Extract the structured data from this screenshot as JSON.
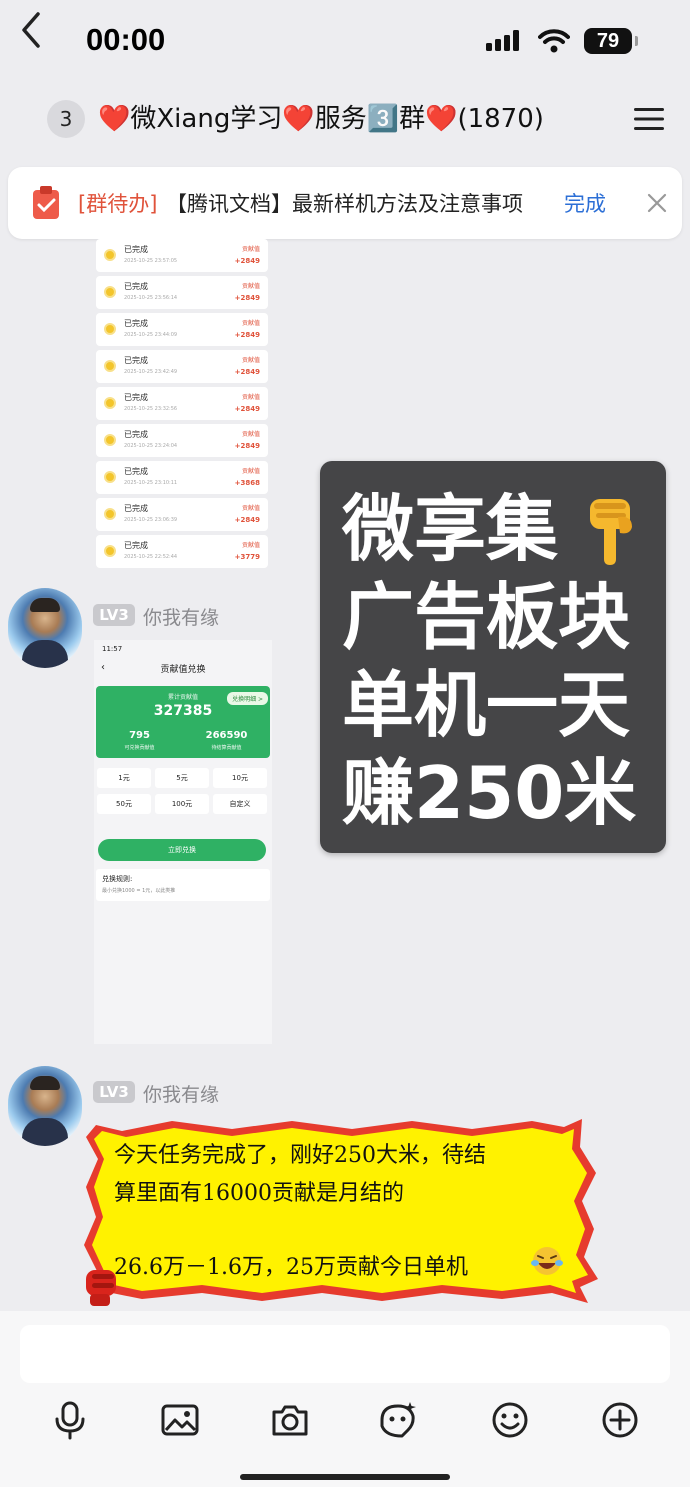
{
  "status_bar": {
    "time": "00:00",
    "battery": "79"
  },
  "header": {
    "back_badge": "3",
    "title": "❤️微Xiang学习❤️服务3️⃣群❤️(1870)"
  },
  "todo_bar": {
    "tag": "[群待办]",
    "text": "【腾讯文档】最新样机方法及注意事项",
    "action": "完成"
  },
  "records": [
    {
      "status": "已完成",
      "date": "2025-10-25 23:57:05",
      "label": "贡献值",
      "amount": "+2849"
    },
    {
      "status": "已完成",
      "date": "2025-10-25 23:56:14",
      "label": "贡献值",
      "amount": "+2849"
    },
    {
      "status": "已完成",
      "date": "2025-10-25 23:44:09",
      "label": "贡献值",
      "amount": "+2849"
    },
    {
      "status": "已完成",
      "date": "2025-10-25 23:42:49",
      "label": "贡献值",
      "amount": "+2849"
    },
    {
      "status": "已完成",
      "date": "2025-10-25 23:32:56",
      "label": "贡献值",
      "amount": "+2849"
    },
    {
      "status": "已完成",
      "date": "2025-10-25 23:24:04",
      "label": "贡献值",
      "amount": "+2849"
    },
    {
      "status": "已完成",
      "date": "2025-10-25 23:10:11",
      "label": "贡献值",
      "amount": "+3868"
    },
    {
      "status": "已完成",
      "date": "2025-10-25 23:06:39",
      "label": "贡献值",
      "amount": "+2849"
    },
    {
      "status": "已完成",
      "date": "2025-10-25 22:52:44",
      "label": "贡献值",
      "amount": "+3779"
    }
  ],
  "msg1": {
    "level": "LV3",
    "sender": "你我有缘"
  },
  "exchange": {
    "phone_time": "11:57",
    "title": "贡献值兑换",
    "total_label": "累计贡献值",
    "total": "327385",
    "detail_btn": "兑换明细 >",
    "available": "795",
    "available_label": "可兑换贡献值",
    "pending": "266590",
    "pending_label": "待结算贡献值",
    "options": [
      "1元",
      "5元",
      "10元",
      "50元",
      "100元",
      "自定义"
    ],
    "submit": "立即兑换",
    "rule_title": "兑换规则:",
    "rule_text": "最小兑换1000 = 1元，以此类推"
  },
  "ad_card": {
    "lines": [
      "微享集",
      "广告板块",
      "单机一天",
      "赚250米"
    ]
  },
  "msg2": {
    "level": "LV3",
    "sender": "你我有缘",
    "lines": [
      "今天任务完成了，刚好250大米，待结",
      "算里面有16000贡献是月结的",
      "26.6万－1.6万，25万贡献今日单机"
    ]
  },
  "toolbar": {
    "icons": [
      "mic-icon",
      "image-icon",
      "camera-icon",
      "sticker-icon",
      "emoji-icon",
      "plus-icon"
    ]
  },
  "colors": {
    "bubble_fill": "#fff200",
    "bubble_border": "#e63b2e",
    "green": "#2fb164",
    "link_blue": "#2c6fd6"
  }
}
